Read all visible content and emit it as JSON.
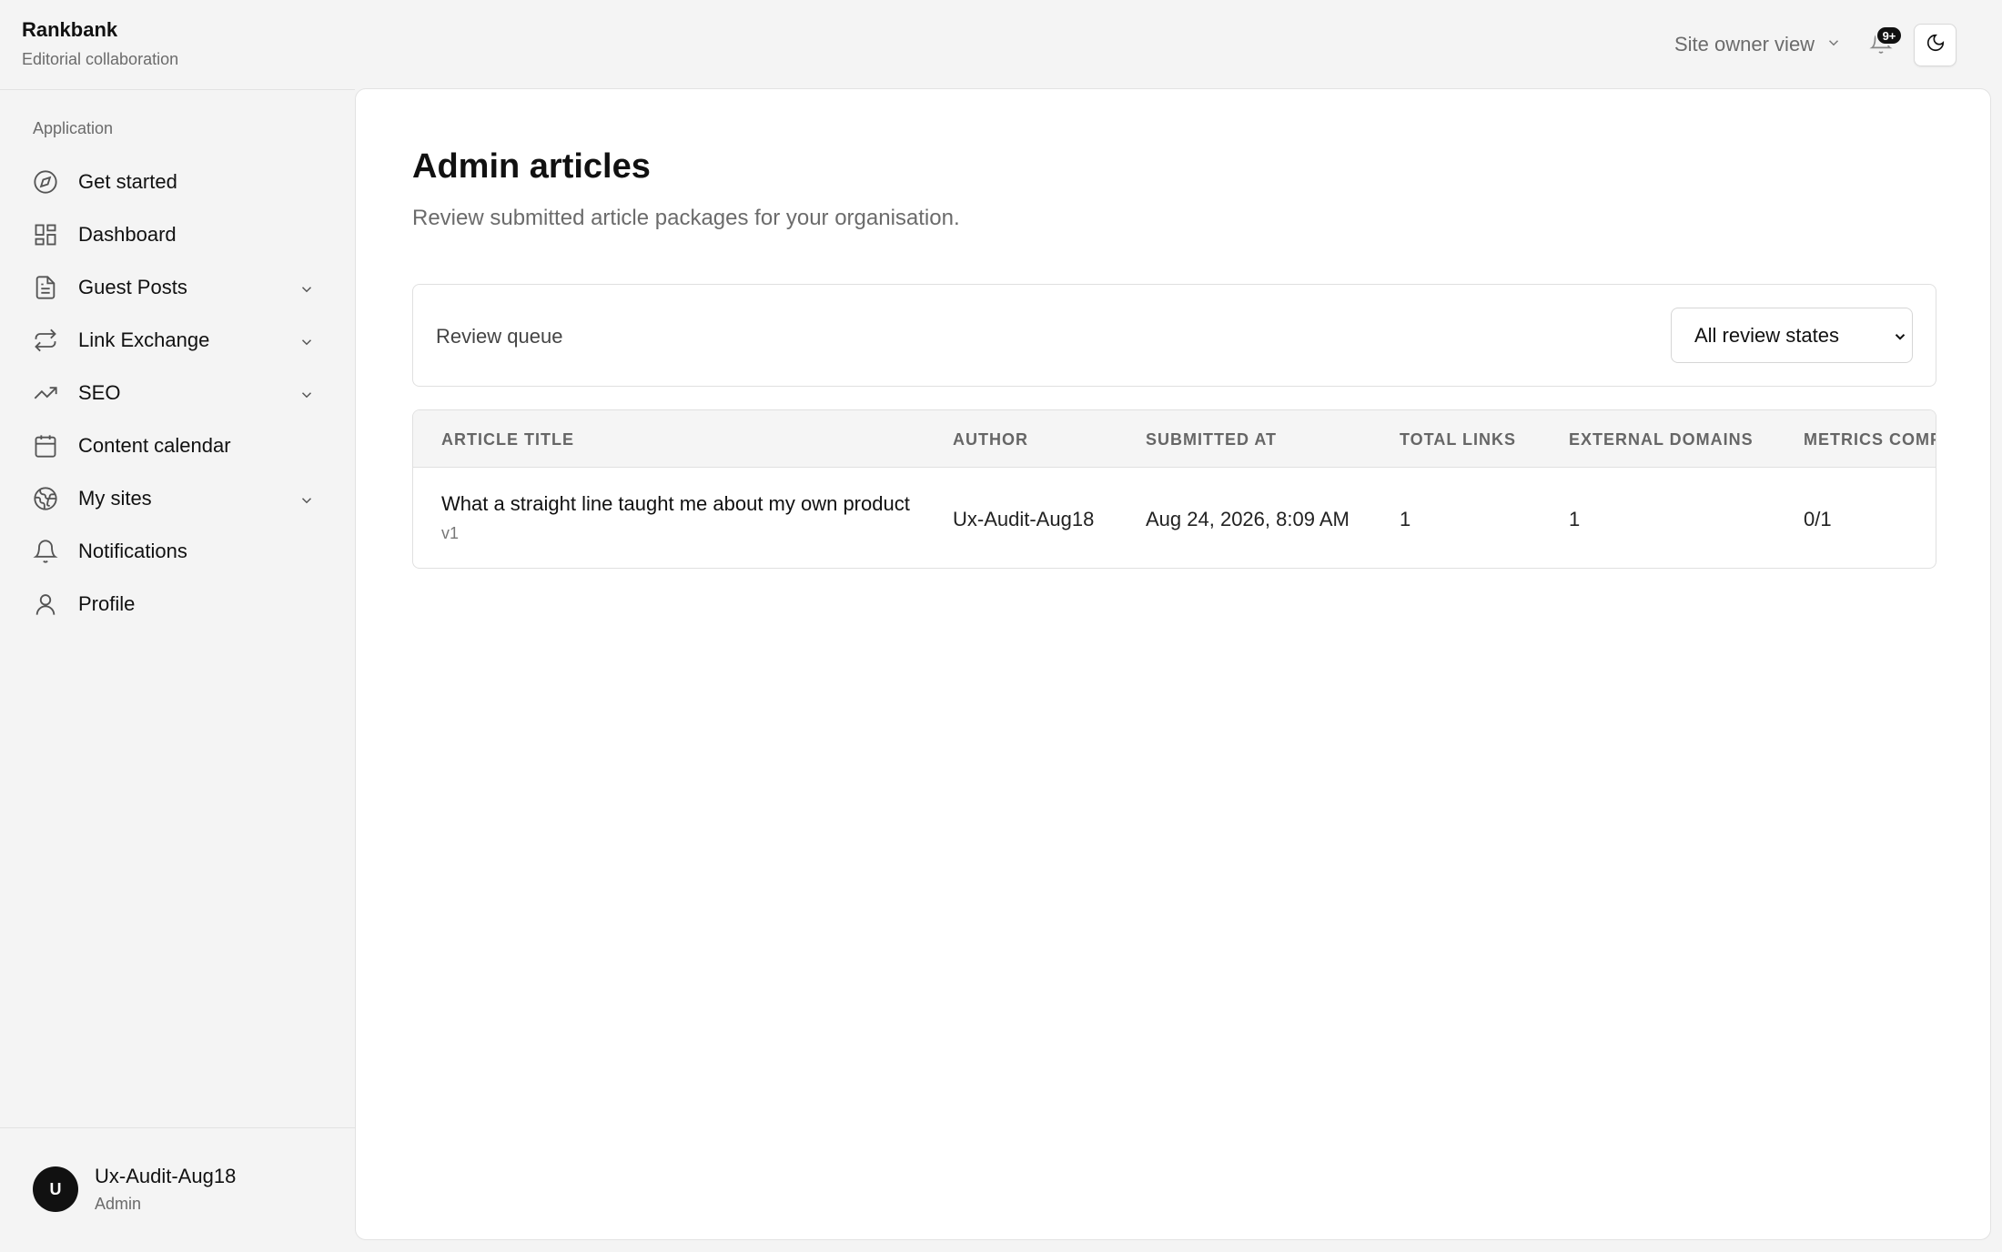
{
  "brand": {
    "name": "Rankbank",
    "subtitle": "Editorial collaboration"
  },
  "topbar": {
    "view_label": "Site owner view",
    "notification_badge": "9+"
  },
  "sidebar": {
    "section_label": "Application",
    "items": [
      {
        "label": "Get started",
        "icon": "compass-icon",
        "expandable": false
      },
      {
        "label": "Dashboard",
        "icon": "dashboard-icon",
        "expandable": false
      },
      {
        "label": "Guest Posts",
        "icon": "document-icon",
        "expandable": true
      },
      {
        "label": "Link Exchange",
        "icon": "exchange-icon",
        "expandable": true
      },
      {
        "label": "SEO",
        "icon": "trending-icon",
        "expandable": true
      },
      {
        "label": "Content calendar",
        "icon": "calendar-icon",
        "expandable": false
      },
      {
        "label": "My sites",
        "icon": "globe-icon",
        "expandable": true
      },
      {
        "label": "Notifications",
        "icon": "bell-icon",
        "expandable": false
      },
      {
        "label": "Profile",
        "icon": "user-icon",
        "expandable": false
      }
    ],
    "user": {
      "initial": "U",
      "name": "Ux-Audit-Aug18",
      "role": "Admin"
    }
  },
  "main": {
    "title": "Admin articles",
    "subtitle": "Review submitted article packages for your organisation.",
    "filter": {
      "label": "Review queue",
      "selected": "All review states"
    },
    "table": {
      "columns": [
        "ARTICLE TITLE",
        "AUTHOR",
        "SUBMITTED AT",
        "TOTAL LINKS",
        "EXTERNAL DOMAINS",
        "METRICS COMP"
      ],
      "rows": [
        {
          "title": "What a straight line taught me about my own product",
          "version": "v1",
          "author": "Ux-Audit-Aug18",
          "submitted_at": "Aug 24, 2026, 8:09 AM",
          "total_links": "1",
          "external_domains": "1",
          "metrics": "0/1"
        }
      ]
    }
  }
}
